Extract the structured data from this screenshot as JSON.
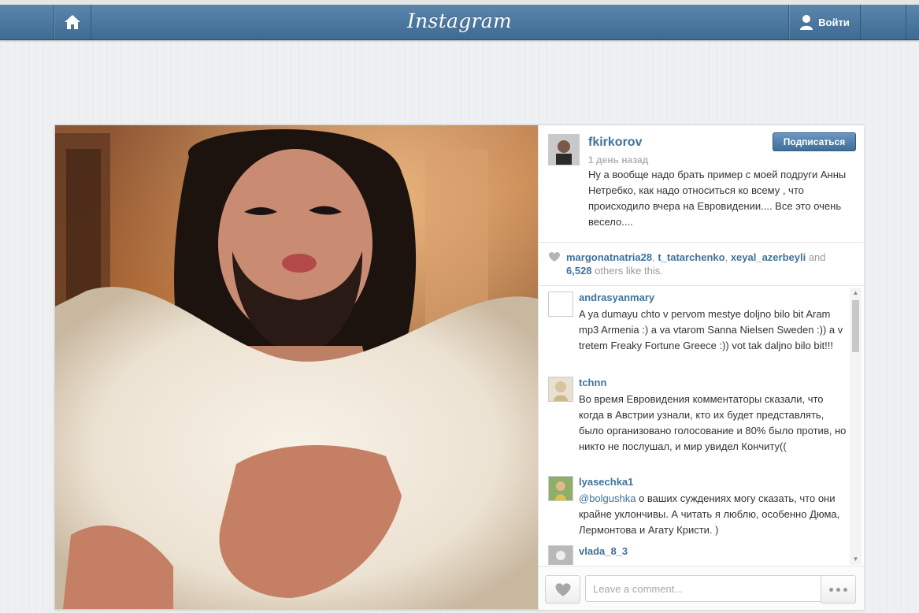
{
  "nav": {
    "logo": "Instagram",
    "login_label": "Войти"
  },
  "post": {
    "owner": {
      "username": "fkirkorov",
      "time": "1 день назад",
      "caption": "Ну а вообще надо брать пример с моей подруги Анны Нетребко, как надо относиться ко всему , что происходило вчера на Евровидении.... Все это очень весело....",
      "follow_label": "Подписаться"
    },
    "likes": {
      "users": [
        "margonatnatria28",
        "t_tatarchenko",
        "xeyal_azerbeyli"
      ],
      "sep1": ", ",
      "sep2": ", ",
      "and_word": " and ",
      "count": "6,528",
      "others_text": " others like this."
    },
    "comments": [
      {
        "username": "andrasyanmary",
        "text": "A ya dumayu chto v pervom mestye doljno bilo bit Aram mp3 Armenia :) a va vtarom Sanna Nielsen Sweden :)) a v tretem Freaky Fortune Greece :)) vot tak daljno bilo bit!!!"
      },
      {
        "username": "tchnn",
        "text": "Во время Евровидения комментаторы сказали, что когда в Австрии узнали, кто их будет представлять, было организовано голосование и 80% было против, но никто не послушал, и мир увидел Кончиту(("
      },
      {
        "username": "lyasechka1",
        "mention": "@bolgushka",
        "text": " о ваших суждениях могу сказать, что они крайне уклончивы. А читать я люблю, особенно Дюма, Лермонтова и Агату Кристи. )"
      },
      {
        "username": "vlada_8_3",
        "text": ""
      }
    ],
    "comment_placeholder": "Leave a comment..."
  },
  "colors": {
    "nav_blue": "#4a769e",
    "link_blue": "#3f729b",
    "follow_blue": "#4f7fab"
  }
}
